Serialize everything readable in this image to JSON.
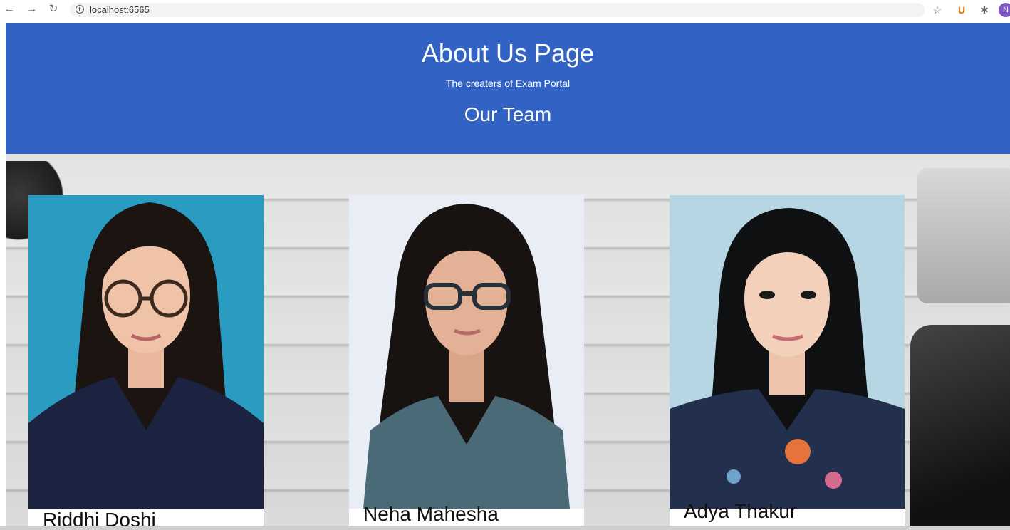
{
  "browser": {
    "url": "localhost:6565",
    "profile_initial": "N"
  },
  "header": {
    "title": "About Us Page",
    "subtitle": "The creaters of Exam Portal",
    "team_heading": "Our Team"
  },
  "team": [
    {
      "name": "Riddhi Doshi",
      "photo_bg": "#2a9bc1",
      "shirt": "#1c2340",
      "glasses": true
    },
    {
      "name": "Neha Mahesha",
      "photo_bg": "#e9eef6",
      "shirt": "#4b6a78",
      "glasses": true
    },
    {
      "name": "Adya Thakur",
      "photo_bg": "#b7d6e4",
      "shirt": "#22304e",
      "glasses": false
    }
  ]
}
